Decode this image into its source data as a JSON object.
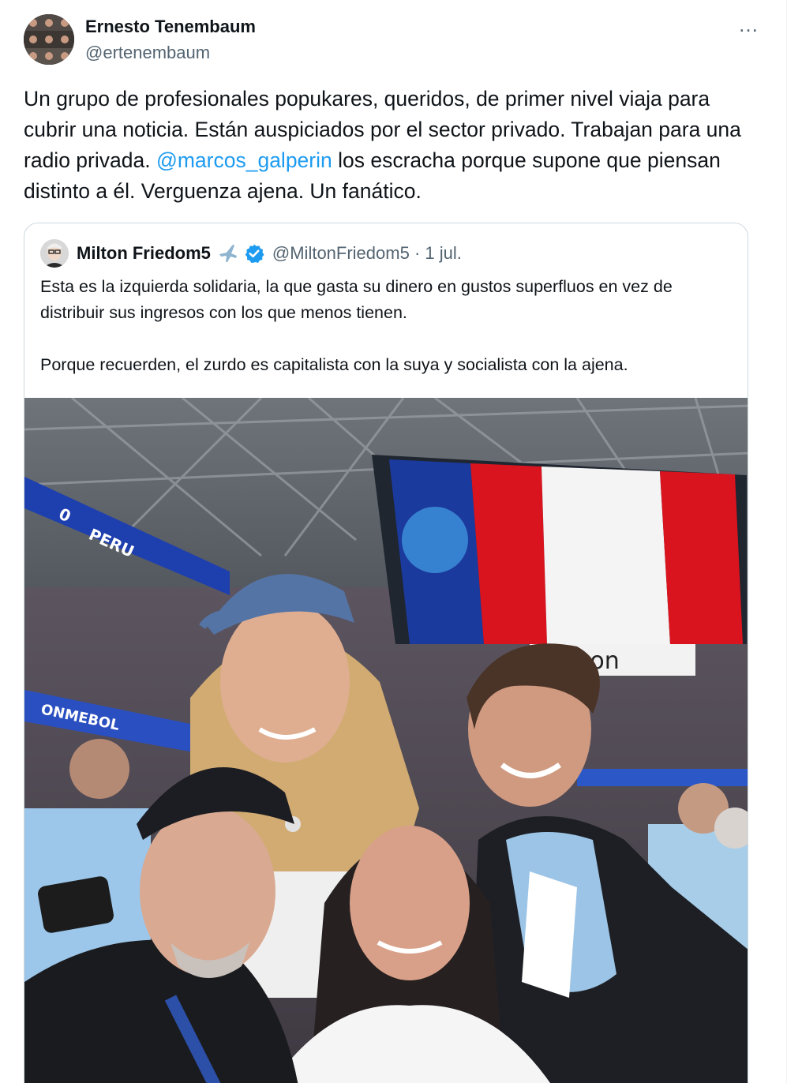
{
  "tweet": {
    "author_name": "Ernesto Tenembaum",
    "author_handle": "@ertenembaum",
    "more_icon": "…",
    "text_part1": "Un grupo de profesionales popukares, queridos, de primer nivel viaja para cubrir una noticia. Están auspiciados por el sector privado. Trabajan para una radio privada. ",
    "mention": "@marcos_galperin",
    "text_part2": " los escracha porque supone que piensan distinto a él. Verguenza ajena. Un fanático."
  },
  "quoted_tweet": {
    "author_name": "Milton Friedom5",
    "author_handle": "@MiltonFriedom5",
    "date": "1 jul.",
    "separator": "·",
    "paragraph1": "Esta es la izquierda solidaria, la que gasta su dinero en gustos superfluos en vez de distribuir sus ingresos con los que menos tienen.",
    "paragraph2": "Porque recuerden, el zurdo es capitalista con la suya y socialista con la ajena."
  },
  "photo": {
    "score_team": "PERU",
    "score_value": "0",
    "sponsor_text": "rizon",
    "banner_text": "ONMEBOL"
  },
  "colors": {
    "link": "#1d9bf0",
    "verified": "#1d9bf0",
    "secondary_text": "#536471",
    "border": "#cfd9de",
    "peru_red": "#d9141f"
  }
}
